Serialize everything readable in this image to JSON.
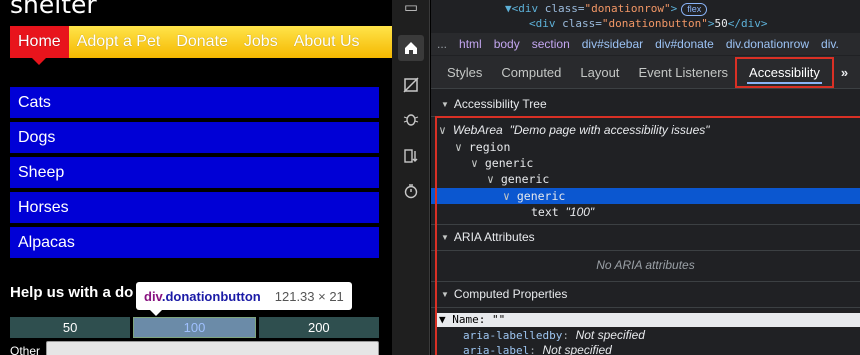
{
  "site": {
    "title": "shelter",
    "nav": [
      "Home",
      "Adopt a Pet",
      "Donate",
      "Jobs",
      "About Us"
    ],
    "sidebar_items": [
      "Cats",
      "Dogs",
      "Sheep",
      "Horses",
      "Alpacas"
    ],
    "help_heading": "Help us with a do",
    "donation_buttons": [
      "50",
      "100",
      "200"
    ],
    "other_label": "Other",
    "tooltip": {
      "selector_tag": "div",
      "selector_class": ".donationbutton",
      "size": "121.33 × 21"
    }
  },
  "activity_icons": [
    "panel-icon",
    "home-icon",
    "no-device-icon",
    "bug-icon",
    "sort-icon",
    "timer-icon"
  ],
  "dom": {
    "line1_tag_open": "▼<div",
    "line1_attr": " class=",
    "line1_val": "\"donationrow\"",
    "line1_close": ">",
    "line1_badge": "flex",
    "line2_tag_open": "<div",
    "line2_attr": " class=",
    "line2_val": "\"donationbutton\"",
    "line2_close": ">",
    "line2_text": "50",
    "line2_end": "</div>"
  },
  "breadcrumbs": [
    "...",
    "html",
    "body",
    "section",
    "div#sidebar",
    "div#donate",
    "div.donationrow",
    "div."
  ],
  "tabs": [
    "Styles",
    "Computed",
    "Layout",
    "Event Listeners",
    "Accessibility",
    "»"
  ],
  "sections": {
    "tree": "Accessibility Tree",
    "aria": "ARIA Attributes",
    "computed": "Computed Properties"
  },
  "tree": {
    "webarea_role": "WebArea",
    "webarea_name": "\"Demo page with accessibility issues\"",
    "region": "region",
    "generic1": "generic",
    "generic2": "generic",
    "generic3": "generic",
    "text_role": "text",
    "text_value": "\"100\""
  },
  "no_aria": "No ARIA attributes",
  "computed": {
    "name_row": "▼ Name: \"\"",
    "prop1_key": "aria-labelledby",
    "prop1_val": "Not specified",
    "prop2_key": "aria-label",
    "prop2_val": "Not specified"
  },
  "colors": {
    "accent_red": "#d93025",
    "selection_blue": "#0b57d0",
    "nav_red": "#e8141c",
    "sidebar_blue": "#0000d6"
  }
}
